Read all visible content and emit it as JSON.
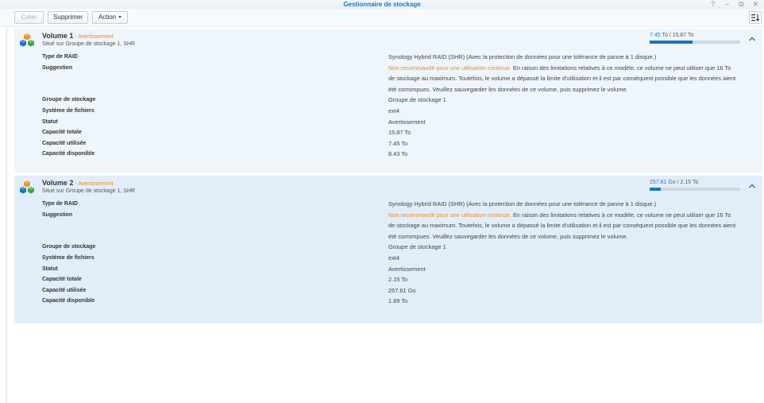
{
  "window": {
    "title": "Gestionnaire de stockage",
    "buttons": [
      "?",
      "–",
      "⧉",
      "✕"
    ]
  },
  "toolbar": {
    "create_label": "Créer",
    "delete_label": "Supprimer",
    "action_label": "Action"
  },
  "volumes": [
    {
      "name": "Volume 1",
      "separator": " - ",
      "status_badge": "Avertissement",
      "location": "Situé sur Groupe de stockage 1, SHR",
      "usage": {
        "used": "7.45 To",
        "slash": " / ",
        "total": "15.87 To",
        "fraction": 0.47
      },
      "fields": {
        "raid_type_label": "Type de RAID",
        "raid_type_value": "Synology Hybrid RAID (SHR) (Avec la protection de données pour une tolérance de panne à 1 disque.)",
        "suggestion_label": "Suggestion",
        "suggestion_warning": "Non recommandé pour une utilisation continue.",
        "suggestion_text": " En raison des limitations relatives à ce modèle, ce volume ne peut utiliser que 16 To de stockage au maximum. Toutefois, le volume a dépassé la limite d'utilisation et il est par conséquent possible que les données aient été corrompues. Veuillez sauvegarder les données de ce volume, puis supprimez le volume.",
        "storage_pool_label": "Groupe de stockage",
        "storage_pool_value": "Groupe de stockage 1",
        "filesystem_label": "Système de fichiers",
        "filesystem_value": "ext4",
        "status_label": "Statut",
        "status_value": "Avertissement",
        "total_label": "Capacité totale",
        "total_value": "15.87 To",
        "used_label": "Capacité utilisée",
        "used_value": "7.45 To",
        "free_label": "Capacité disponible",
        "free_value": "8.43 To"
      }
    },
    {
      "name": "Volume 2",
      "separator": " - ",
      "status_badge": "Avertissement",
      "location": "Situé sur Groupe de stockage 1, SHR",
      "usage": {
        "used": "257.61 Go",
        "slash": " / ",
        "total": "2.15 To",
        "fraction": 0.12
      },
      "fields": {
        "raid_type_label": "Type de RAID",
        "raid_type_value": "Synology Hybrid RAID (SHR) (Avec la protection de données pour une tolérance de panne à 1 disque.)",
        "suggestion_label": "Suggestion",
        "suggestion_warning": "Non recommandé pour une utilisation continue.",
        "suggestion_text": " En raison des limitations relatives à ce modèle, ce volume ne peut utiliser que 16 To de stockage au maximum. Toutefois, le volume a dépassé la limite d'utilisation et il est par conséquent possible que les données aient été corrompues. Veuillez sauvegarder les données de ce volume, puis supprimez le volume.",
        "storage_pool_label": "Groupe de stockage",
        "storage_pool_value": "Groupe de stockage 1",
        "filesystem_label": "Système de fichiers",
        "filesystem_value": "ext4",
        "status_label": "Statut",
        "status_value": "Avertissement",
        "total_label": "Capacité totale",
        "total_value": "2.15 To",
        "used_label": "Capacité utilisée",
        "used_value": "257.61 Go",
        "free_label": "Capacité disponible",
        "free_value": "1.89 To"
      }
    }
  ],
  "colors": {
    "accent": "#1b75bb",
    "warning": "#f08a24",
    "panel_1": "#eef5fb",
    "panel_2": "#e1eefa"
  },
  "icons": {
    "volume": "storage-cubes-icon",
    "collapse": "chevron-up-icon",
    "sort": "sort-icon",
    "dropdown": "caret-down-icon"
  }
}
